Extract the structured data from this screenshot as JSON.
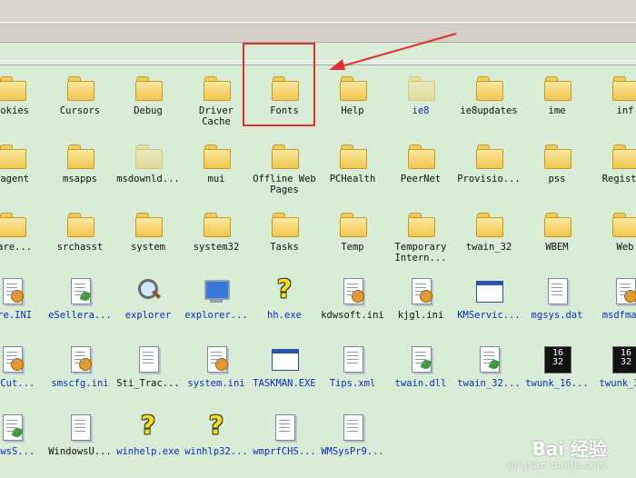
{
  "items": [
    {
      "label": "ookies",
      "type": "folder",
      "blue": false
    },
    {
      "label": "Cursors",
      "type": "folder",
      "blue": false
    },
    {
      "label": "Debug",
      "type": "folder",
      "blue": false
    },
    {
      "label": "Driver\nCache",
      "type": "folder",
      "blue": false
    },
    {
      "label": "Fonts",
      "type": "folder",
      "blue": false
    },
    {
      "label": "Help",
      "type": "folder",
      "blue": false
    },
    {
      "label": "ie8",
      "type": "folder",
      "blue": true,
      "faded": true
    },
    {
      "label": "ie8updates",
      "type": "folder",
      "blue": false
    },
    {
      "label": "ime",
      "type": "folder",
      "blue": false
    },
    {
      "label": "inf",
      "type": "folder",
      "blue": false
    },
    {
      "label": "sagent",
      "type": "folder",
      "blue": false
    },
    {
      "label": "msapps",
      "type": "folder",
      "blue": false
    },
    {
      "label": "msdownld...",
      "type": "folder",
      "blue": false,
      "faded": true
    },
    {
      "label": "mui",
      "type": "folder",
      "blue": false
    },
    {
      "label": "Offline Web\nPages",
      "type": "folder",
      "blue": false
    },
    {
      "label": "PCHealth",
      "type": "folder",
      "blue": false
    },
    {
      "label": "PeerNet",
      "type": "folder",
      "blue": false
    },
    {
      "label": "Provisio...",
      "type": "folder",
      "blue": false
    },
    {
      "label": "pss",
      "type": "folder",
      "blue": false
    },
    {
      "label": "Register",
      "type": "folder",
      "blue": false
    },
    {
      "label": "ware...",
      "type": "folder",
      "blue": false
    },
    {
      "label": "srchasst",
      "type": "folder",
      "blue": false
    },
    {
      "label": "system",
      "type": "folder",
      "blue": false
    },
    {
      "label": "system32",
      "type": "folder",
      "blue": false
    },
    {
      "label": "Tasks",
      "type": "folder",
      "blue": false
    },
    {
      "label": "Temp",
      "type": "folder",
      "blue": false
    },
    {
      "label": "Temporary\nIntern...",
      "type": "folder",
      "blue": false
    },
    {
      "label": "twain_32",
      "type": "folder",
      "blue": false
    },
    {
      "label": "WBEM",
      "type": "folder",
      "blue": false
    },
    {
      "label": "Web",
      "type": "folder",
      "blue": false
    },
    {
      "label": "ore.INI",
      "type": "gear",
      "blue": true
    },
    {
      "label": "eSellera...",
      "type": "leaf",
      "blue": true
    },
    {
      "label": "explorer",
      "type": "mag",
      "blue": true
    },
    {
      "label": "explorer...",
      "type": "monitor",
      "blue": true
    },
    {
      "label": "hh.exe",
      "type": "help",
      "blue": true
    },
    {
      "label": "kdwsoft.ini",
      "type": "gear",
      "blue": false
    },
    {
      "label": "kjgl.ini",
      "type": "gear",
      "blue": false
    },
    {
      "label": "KMServic...",
      "type": "win",
      "blue": true
    },
    {
      "label": "mgsys.dat",
      "type": "doc",
      "blue": true
    },
    {
      "label": "msdfmap.",
      "type": "gear",
      "blue": true
    },
    {
      "label": "rtCut...",
      "type": "gear",
      "blue": true
    },
    {
      "label": "smscfg.ini",
      "type": "gear",
      "blue": true
    },
    {
      "label": "Sti_Trac...",
      "type": "doc",
      "blue": false
    },
    {
      "label": "system.ini",
      "type": "gear",
      "blue": true
    },
    {
      "label": "TASKMAN.EXE",
      "type": "win",
      "blue": true
    },
    {
      "label": "Tips.xml",
      "type": "doc",
      "blue": true
    },
    {
      "label": "twain.dll",
      "type": "leaf",
      "blue": true
    },
    {
      "label": "twain_32...",
      "type": "leaf",
      "blue": true
    },
    {
      "label": "twunk_16...",
      "type": "twunk",
      "blue": true
    },
    {
      "label": "twunk_32.",
      "type": "twunk",
      "blue": true
    },
    {
      "label": "dowsS...",
      "type": "leaf",
      "blue": true
    },
    {
      "label": "WindowsU...",
      "type": "doc",
      "blue": false
    },
    {
      "label": "winhelp.exe",
      "type": "help",
      "blue": true
    },
    {
      "label": "winhlp32...",
      "type": "help",
      "blue": true
    },
    {
      "label": "wmprfCHS...",
      "type": "doc",
      "blue": true
    },
    {
      "label": "WMSysPr9...",
      "type": "doc",
      "blue": true
    }
  ],
  "twunk_text": "16\n32",
  "watermark": {
    "line1": "Bai 经验",
    "line2": "jingyan.baidu.com"
  },
  "colors": {
    "highlight": "#e03030",
    "bg": "#d8ecd6"
  }
}
